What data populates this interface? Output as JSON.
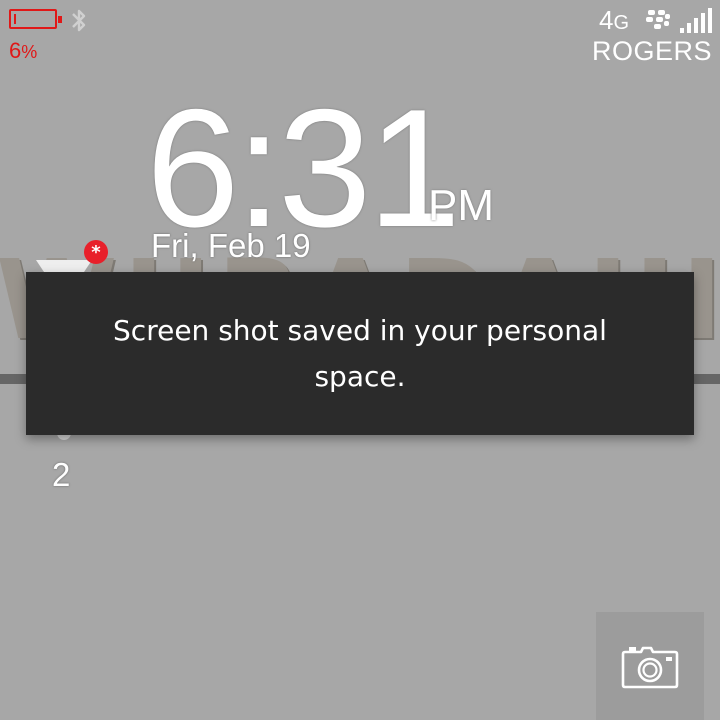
{
  "status_bar": {
    "battery_percent_value": "6",
    "battery_percent_sign": "%",
    "battery_level": 0.06,
    "battery_color": "#e01818",
    "bluetooth_icon": "bluetooth-icon",
    "network_type_prefix": "4",
    "network_type_suffix": "G",
    "blackberry_icon": "blackberry-logo-icon",
    "signal_icon": "signal-bars-icon",
    "carrier": "ROGERS"
  },
  "lock_screen": {
    "time": "6:31",
    "ampm": "PM",
    "date": "Fri, Feb 19",
    "message_badge": "*",
    "other_notification_count": "2"
  },
  "toast": {
    "message": "Screen shot saved in your personal space."
  },
  "camera_button": {
    "icon": "camera-icon"
  },
  "colors": {
    "background": "#a7a7a7",
    "toast_background": "#2b2b2b",
    "badge": "#e8202a"
  }
}
